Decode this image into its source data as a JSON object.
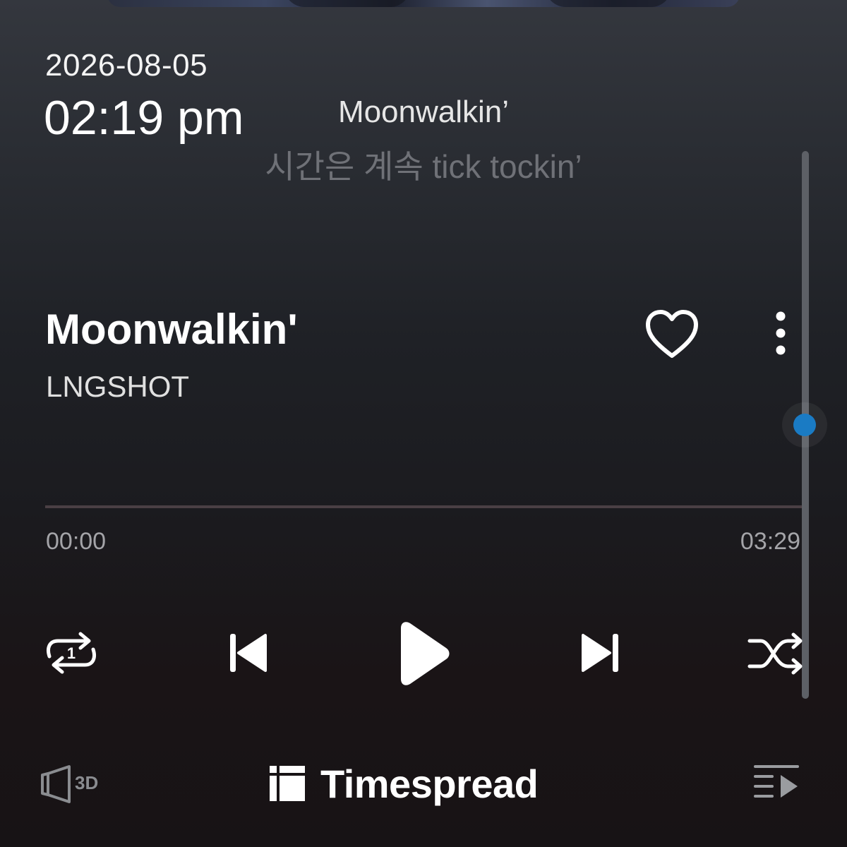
{
  "clock": {
    "date": "2026-08-05",
    "time": "02:19 pm"
  },
  "lyrics": {
    "current": "Moonwalkin’",
    "next": "시간은 계속 tick tockin’"
  },
  "track": {
    "title": "Moonwalkin'",
    "artist": "LNGSHOT",
    "favorite": false
  },
  "progress": {
    "elapsed": "00:00",
    "total": "03:29",
    "fraction": 0
  },
  "side_slider": {
    "level": 0.5
  },
  "controls": {
    "repeat_mode": "repeat-one",
    "repeat_badge": "1",
    "state": "paused"
  },
  "footer": {
    "effect_label": "3D",
    "brand": "Timespread"
  },
  "colors": {
    "accent": "#1a7bc4",
    "text_primary": "#ffffff",
    "text_secondary": "#a4a4a8",
    "lyric_dim": "#6f7177"
  },
  "icons": {
    "favorite": "heart-outline-icon",
    "more": "more-vertical-icon",
    "repeat": "repeat-one-icon",
    "previous": "skip-previous-icon",
    "play": "play-icon",
    "next": "skip-next-icon",
    "shuffle": "shuffle-icon",
    "effect": "3d-audio-icon",
    "queue": "playlist-icon",
    "brand": "timespread-logo-icon"
  }
}
